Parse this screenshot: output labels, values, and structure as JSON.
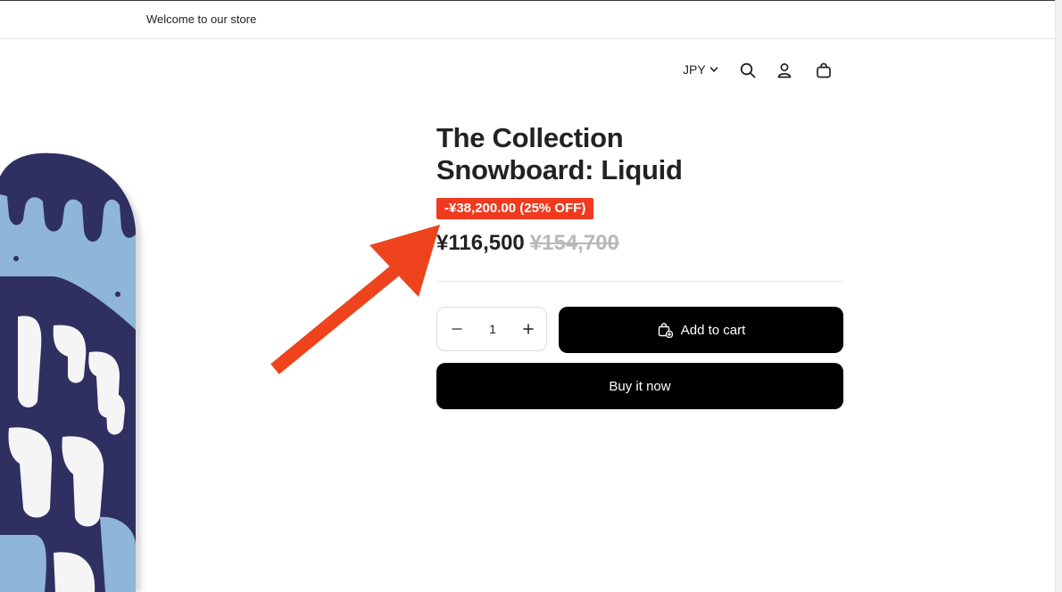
{
  "announcement": {
    "text": "Welcome to our store"
  },
  "header": {
    "currency": "JPY",
    "icons": [
      "search-icon",
      "account-icon",
      "cart-icon",
      "chevron-down-icon"
    ]
  },
  "product": {
    "title_line1": "The Collection",
    "title_line2": "Snowboard: Liquid",
    "discount_badge": "-¥38,200.00 (25% OFF)",
    "price_current": "¥116,500",
    "price_original": "¥154,700",
    "quantity": "1",
    "add_to_cart_label": "Add to cart",
    "buy_now_label": "Buy it now"
  },
  "colors": {
    "badge": "#ef3a1f",
    "arrow": "#ee431c",
    "button": "#000000",
    "board_navy": "#2f2f62",
    "board_blue": "#8fb5d8"
  }
}
